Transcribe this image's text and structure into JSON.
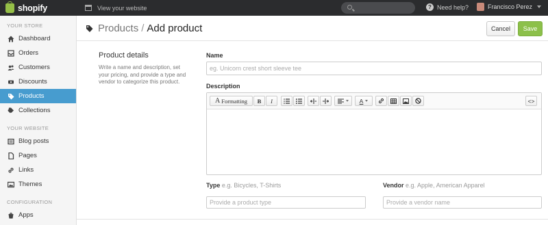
{
  "topbar": {
    "brand": "shopify",
    "view_site": "View your website",
    "help": "Need help?",
    "user_name": "Francisco Perez"
  },
  "sidebar": {
    "sections": [
      {
        "label": "YOUR STORE",
        "items": [
          {
            "label": "Dashboard",
            "icon": "home-icon"
          },
          {
            "label": "Orders",
            "icon": "inbox-icon"
          },
          {
            "label": "Customers",
            "icon": "users-icon"
          },
          {
            "label": "Discounts",
            "icon": "discount-icon"
          },
          {
            "label": "Products",
            "icon": "tag-icon",
            "active": true
          },
          {
            "label": "Collections",
            "icon": "collections-icon"
          }
        ]
      },
      {
        "label": "YOUR WEBSITE",
        "items": [
          {
            "label": "Blog posts",
            "icon": "blog-icon"
          },
          {
            "label": "Pages",
            "icon": "pages-icon"
          },
          {
            "label": "Links",
            "icon": "link-icon"
          },
          {
            "label": "Themes",
            "icon": "themes-icon"
          }
        ]
      },
      {
        "label": "CONFIGURATION",
        "items": [
          {
            "label": "Apps",
            "icon": "apps-icon"
          }
        ]
      }
    ]
  },
  "header": {
    "breadcrumb": "Products",
    "separator": "/",
    "title": "Add product",
    "cancel": "Cancel",
    "save": "Save",
    "save_color": "#8cc04a"
  },
  "details": {
    "heading": "Product details",
    "description": "Write a name and description, set your pricing, and provide a type and vendor to categorize this product."
  },
  "form": {
    "name_label": "Name",
    "name_placeholder": "eg. Unicorn crest short sleeve tee",
    "description_label": "Description",
    "toolbar": {
      "formatting": "Formatting",
      "bold": "B",
      "italic": "I",
      "font_color": "A",
      "html": "<>"
    },
    "type_label": "Type",
    "type_hint": "e.g. Bicycles, T-Shirts",
    "type_placeholder": "Provide a product type",
    "vendor_label": "Vendor",
    "vendor_hint": "e.g. Apple, American Apparel",
    "vendor_placeholder": "Provide a vendor name"
  }
}
